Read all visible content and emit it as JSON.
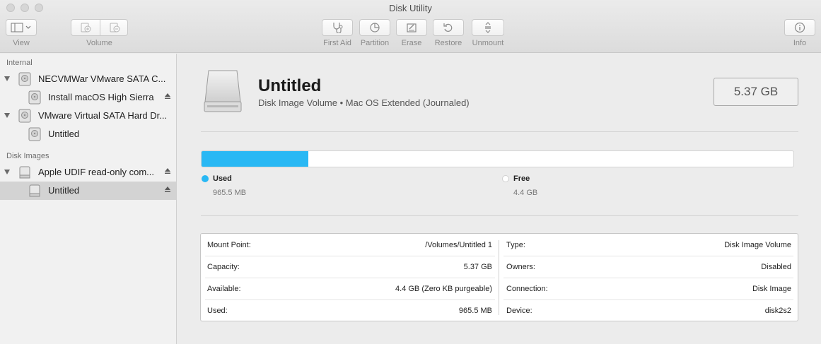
{
  "window": {
    "title": "Disk Utility"
  },
  "toolbar": {
    "view_label": "View",
    "volume_label": "Volume",
    "first_aid_label": "First Aid",
    "partition_label": "Partition",
    "erase_label": "Erase",
    "restore_label": "Restore",
    "unmount_label": "Unmount",
    "info_label": "Info"
  },
  "sidebar": {
    "internal_header": "Internal",
    "disk_images_header": "Disk Images",
    "items": [
      {
        "label": "NECVMWar VMware SATA C...",
        "kind": "disk",
        "eject": false,
        "selected": false
      },
      {
        "label": "Install macOS High Sierra",
        "kind": "volume",
        "eject": true,
        "selected": false
      },
      {
        "label": "VMware Virtual SATA Hard Dr...",
        "kind": "disk",
        "eject": false,
        "selected": false
      },
      {
        "label": "Untitled",
        "kind": "volume",
        "eject": false,
        "selected": false
      },
      {
        "label": "Apple UDIF read-only com...",
        "kind": "image",
        "eject": true,
        "selected": false
      },
      {
        "label": "Untitled",
        "kind": "image-volume",
        "eject": true,
        "selected": true
      }
    ]
  },
  "volume": {
    "name": "Untitled",
    "subtitle": "Disk Image Volume • Mac OS Extended (Journaled)",
    "size": "5.37 GB",
    "used_fraction": 0.18
  },
  "usage": {
    "used_label": "Used",
    "used_value": "965.5 MB",
    "used_color": "#29b8f4",
    "free_label": "Free",
    "free_value": "4.4 GB",
    "free_color": "#ffffff"
  },
  "info": {
    "left": [
      {
        "key": "Mount Point:",
        "value": "/Volumes/Untitled 1"
      },
      {
        "key": "Capacity:",
        "value": "5.37 GB"
      },
      {
        "key": "Available:",
        "value": "4.4 GB (Zero KB purgeable)"
      },
      {
        "key": "Used:",
        "value": "965.5 MB"
      }
    ],
    "right": [
      {
        "key": "Type:",
        "value": "Disk Image Volume"
      },
      {
        "key": "Owners:",
        "value": "Disabled"
      },
      {
        "key": "Connection:",
        "value": "Disk Image"
      },
      {
        "key": "Device:",
        "value": "disk2s2"
      }
    ]
  }
}
